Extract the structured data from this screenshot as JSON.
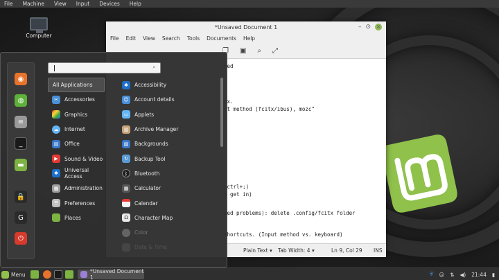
{
  "vm_menubar": [
    "File",
    "Machine",
    "View",
    "Input",
    "Devices",
    "Help"
  ],
  "desktop": {
    "icon_label": "Computer"
  },
  "editor": {
    "title": "*Unsaved Document 1",
    "menu": [
      "File",
      "Edit",
      "View",
      "Search",
      "Tools",
      "Documents",
      "Help"
    ],
    "lines": [
      "ded",
      "ux.",
      "ut method (fcitx/ibus), mozc\"",
      " ctrl+;)",
      "o get in)",
      "ced problems): delete .config/fcitx folder",
      "shortcuts. (Input method vs. keyboard)"
    ],
    "status": {
      "language": "Plain Text",
      "tab_width": "Tab Width: 4",
      "position": "Ln 9, Col 29",
      "mode": "INS"
    }
  },
  "menu": {
    "categories": [
      "All Applications",
      "Accessories",
      "Graphics",
      "Internet",
      "Office",
      "Sound & Video",
      "Universal Access",
      "Administration",
      "Preferences",
      "Places"
    ],
    "apps": [
      "Accessibility",
      "Account details",
      "Applets",
      "Archive Manager",
      "Backgrounds",
      "Backup Tool",
      "Bluetooth",
      "Calculator",
      "Calendar",
      "Character Map",
      "Color",
      "Date & Time"
    ]
  },
  "taskbar": {
    "menu_label": "Menu",
    "task_label": "*Unsaved Document 1",
    "clock": "21:44"
  },
  "colors": {
    "mint_green": "#8fc14b",
    "accent_blue": "#4a90d9"
  }
}
